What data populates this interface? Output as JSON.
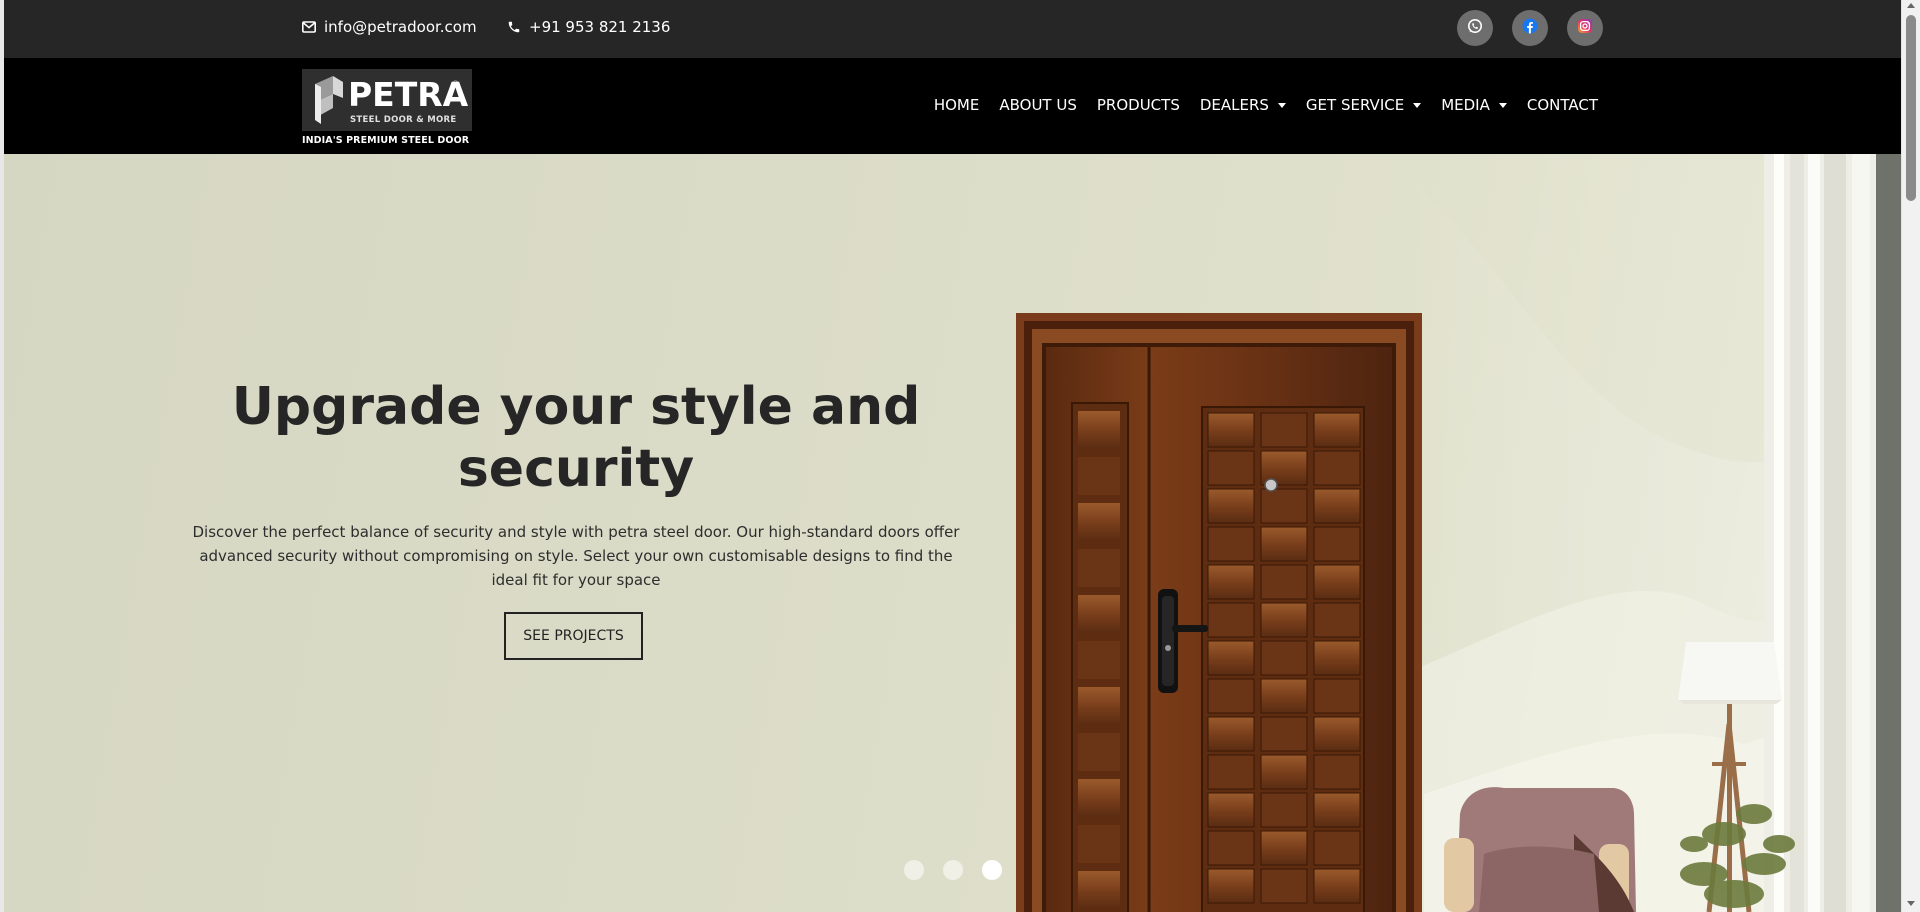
{
  "topbar": {
    "email": "info@petradoor.com",
    "phone": "+91 953 821 2136",
    "social": [
      {
        "name": "whatsapp",
        "icon": "whatsapp-icon"
      },
      {
        "name": "facebook",
        "icon": "facebook-icon"
      },
      {
        "name": "instagram",
        "icon": "instagram-icon"
      }
    ]
  },
  "brand": {
    "name": "PETRA",
    "subtitle": "STEEL DOOR & MORE",
    "tagline": "INDIA'S PREMIUM STEEL DOOR",
    "registered_mark": "®"
  },
  "nav": {
    "items": [
      {
        "label": "HOME",
        "dropdown": false
      },
      {
        "label": "ABOUT US",
        "dropdown": false
      },
      {
        "label": "PRODUCTS",
        "dropdown": false
      },
      {
        "label": "DEALERS",
        "dropdown": true
      },
      {
        "label": "GET SERVICE",
        "dropdown": true
      },
      {
        "label": "MEDIA",
        "dropdown": true
      },
      {
        "label": "CONTACT",
        "dropdown": false
      }
    ]
  },
  "hero": {
    "title": "Upgrade your style and security",
    "description": "Discover the perfect balance of security and style with petra steel door. Our high-standard doors offer advanced security without compromising on style. Select your own customisable designs to find the ideal fit for your space",
    "button_label": "SEE PROJECTS",
    "slides": {
      "count": 3,
      "active": 3
    }
  },
  "colors": {
    "topbar_bg": "#262626",
    "navbar_bg": "#000000",
    "social_bg": "#6e6e6e",
    "hero_text": "#262626"
  }
}
